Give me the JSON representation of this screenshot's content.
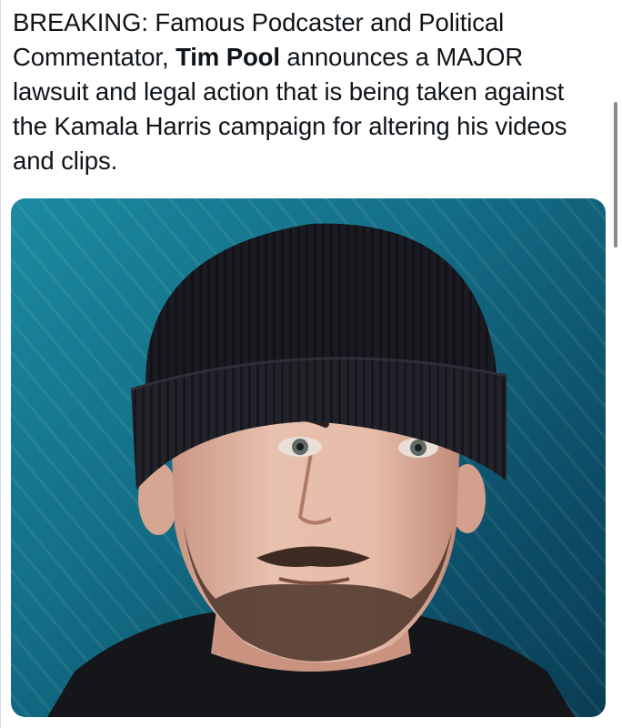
{
  "tweet": {
    "text_before": "BREAKING: Famous Podcaster and Political Commentator, ",
    "mention_name": "Tim Pool",
    "text_after": " announces a MAJOR lawsuit and legal action that is being taken against the Kamala Harris campaign for altering his videos and clips."
  },
  "media": {
    "background_color": "#136e86",
    "beanie_color": "#1a1a22",
    "shirt_color": "#14161a",
    "skin_color": "#e2b7a4"
  }
}
